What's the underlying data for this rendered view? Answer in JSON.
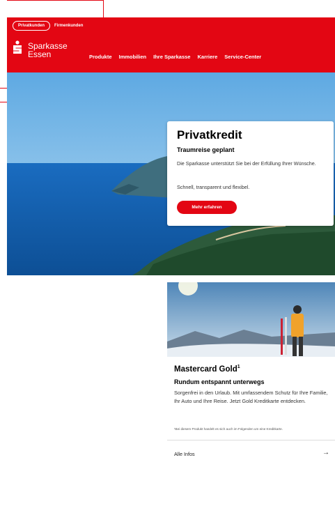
{
  "header": {
    "segment": {
      "active": "Privatkunden",
      "other": "Firmenkunden"
    },
    "logo": {
      "line1": "Sparkasse",
      "line2": "Essen"
    },
    "nav": [
      "Produkte",
      "Immobilien",
      "Ihre Sparkasse",
      "Karriere",
      "Service-Center"
    ]
  },
  "hero_card": {
    "title": "Privatkredit",
    "subtitle": "Traumreise geplant",
    "text1": "Die Sparkasse unterstützt Sie bei der Erfüllung Ihrer Wünsche.",
    "text2": "Schnell, transparent und flexibel.",
    "button": "Mehr erfahren"
  },
  "promo_card": {
    "title": "Mastercard Gold",
    "title_sup": "1",
    "subtitle": "Rundum entspannt unterwegs",
    "text": "Sorgenfrei in den Urlaub. Mit umfassendem Schutz für Ihre Familie, Ihr Auto und Ihre Reise. Jetzt Gold Kreditkarte entdecken.",
    "footnote": "¹Bei diesem Produkt handelt es sich auch im Folgenden um eine Kreditkarte.",
    "link": "Alle Infos",
    "arrow": "→"
  },
  "colors": {
    "brand": "#e30613",
    "sea": "#1c6fc0",
    "sky": "#8cc4ec"
  },
  "icons": {
    "logo": "sparkasse-s-icon",
    "link_arrow": "arrow-right-icon"
  }
}
